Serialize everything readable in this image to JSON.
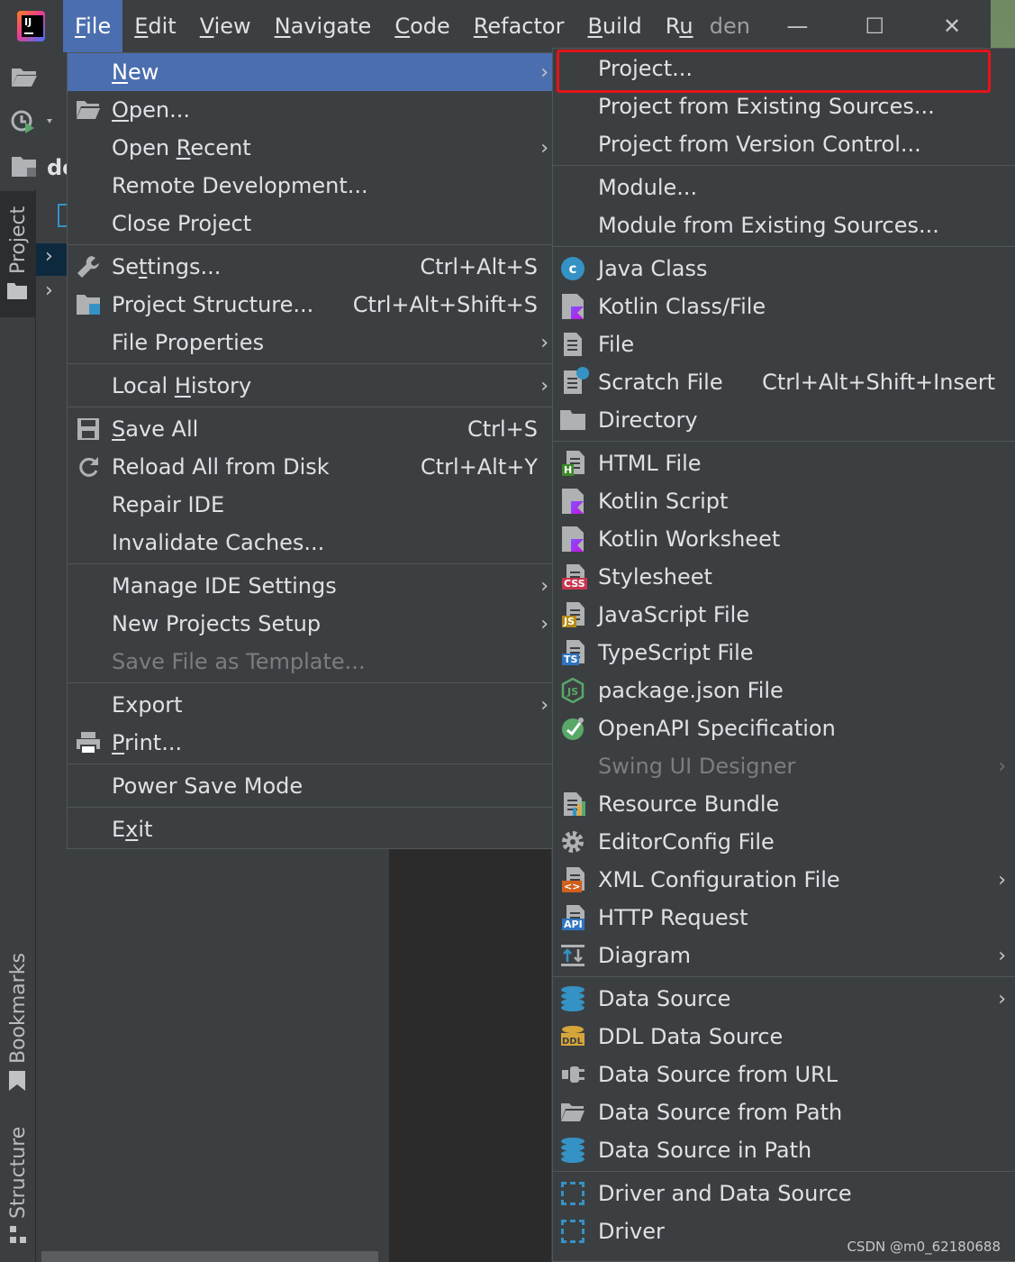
{
  "menubar": {
    "items": [
      "File",
      "Edit",
      "View",
      "Navigate",
      "Code",
      "Refactor",
      "Build",
      "Ru"
    ],
    "mnemonics": [
      "F",
      "E",
      "V",
      "N",
      "C",
      "R",
      "B",
      "u"
    ],
    "window_title": "den"
  },
  "side": {
    "project_tab": "Project",
    "bookmarks_tab": "Bookmarks",
    "structure_tab": "Structure",
    "project_name_fragment": "de"
  },
  "file_menu": [
    {
      "label": "New",
      "mn": "N",
      "submenu": true,
      "selected": true
    },
    {
      "label": "Open...",
      "mn": "O",
      "icon": "folder-open-icon"
    },
    {
      "label": "Open Recent",
      "mn": "R",
      "submenu": true
    },
    {
      "label": "Remote Development..."
    },
    {
      "label": "Close Project"
    },
    {
      "sep": true
    },
    {
      "label": "Settings...",
      "mn": "t",
      "shortcut": "Ctrl+Alt+S",
      "icon": "wrench-icon"
    },
    {
      "label": "Project Structure...",
      "shortcut": "Ctrl+Alt+Shift+S",
      "icon": "project-structure-icon"
    },
    {
      "label": "File Properties",
      "submenu": true
    },
    {
      "sep": true
    },
    {
      "label": "Local History",
      "mn": "H",
      "submenu": true
    },
    {
      "sep": true
    },
    {
      "label": "Save All",
      "mn": "S",
      "shortcut": "Ctrl+S",
      "icon": "save-icon"
    },
    {
      "label": "Reload All from Disk",
      "shortcut": "Ctrl+Alt+Y",
      "icon": "reload-icon"
    },
    {
      "label": "Repair IDE"
    },
    {
      "label": "Invalidate Caches..."
    },
    {
      "sep": true
    },
    {
      "label": "Manage IDE Settings",
      "submenu": true
    },
    {
      "label": "New Projects Setup",
      "submenu": true
    },
    {
      "label": "Save File as Template...",
      "disabled": true
    },
    {
      "sep": true
    },
    {
      "label": "Export",
      "submenu": true
    },
    {
      "label": "Print...",
      "mn": "P",
      "icon": "printer-icon"
    },
    {
      "sep": true
    },
    {
      "label": "Power Save Mode"
    },
    {
      "sep": true
    },
    {
      "label": "Exit",
      "mn": "x"
    }
  ],
  "new_menu": [
    {
      "label": "Project..."
    },
    {
      "label": "Project from Existing Sources..."
    },
    {
      "label": "Project from Version Control..."
    },
    {
      "sep": true
    },
    {
      "label": "Module..."
    },
    {
      "label": "Module from Existing Sources..."
    },
    {
      "sep": true
    },
    {
      "label": "Java Class",
      "icon": "java-class-icon"
    },
    {
      "label": "Kotlin Class/File",
      "icon": "kotlin-class-icon"
    },
    {
      "label": "File",
      "icon": "file-icon"
    },
    {
      "label": "Scratch File",
      "shortcut": "Ctrl+Alt+Shift+Insert",
      "icon": "scratch-file-icon"
    },
    {
      "label": "Directory",
      "icon": "folder-icon"
    },
    {
      "sep": true
    },
    {
      "label": "HTML File",
      "icon": "html-file-icon",
      "badge": "H",
      "badge_color": "#3d8a2a"
    },
    {
      "label": "Kotlin Script",
      "icon": "kotlin-script-icon"
    },
    {
      "label": "Kotlin Worksheet",
      "icon": "kotlin-worksheet-icon"
    },
    {
      "label": "Stylesheet",
      "icon": "stylesheet-icon",
      "badge": "CSS",
      "badge_color": "#c7354f"
    },
    {
      "label": "JavaScript File",
      "icon": "javascript-file-icon",
      "badge": "JS",
      "badge_color": "#b58a12"
    },
    {
      "label": "TypeScript File",
      "icon": "typescript-file-icon",
      "badge": "TS",
      "badge_color": "#2f74c0"
    },
    {
      "label": "package.json File",
      "icon": "nodejs-icon"
    },
    {
      "label": "OpenAPI Specification",
      "icon": "openapi-icon"
    },
    {
      "label": "Swing UI Designer",
      "disabled": true,
      "submenu": true
    },
    {
      "label": "Resource Bundle",
      "icon": "resource-bundle-icon"
    },
    {
      "label": "EditorConfig File",
      "icon": "gear-icon"
    },
    {
      "label": "XML Configuration File",
      "submenu": true,
      "icon": "xml-file-icon",
      "badge": "<>",
      "badge_color": "#d0601b"
    },
    {
      "label": "HTTP Request",
      "icon": "http-request-icon",
      "badge": "API",
      "badge_color": "#2f74c0"
    },
    {
      "label": "Diagram",
      "submenu": true,
      "icon": "diagram-icon"
    },
    {
      "sep": true
    },
    {
      "label": "Data Source",
      "submenu": true,
      "icon": "database-icon"
    },
    {
      "label": "DDL Data Source",
      "icon": "ddl-icon"
    },
    {
      "label": "Data Source from URL",
      "icon": "url-plug-icon"
    },
    {
      "label": "Data Source from Path",
      "icon": "folder-open-icon"
    },
    {
      "label": "Data Source in Path",
      "icon": "database-icon"
    },
    {
      "sep": true
    },
    {
      "label": "Driver and Data Source",
      "icon": "driver-icon"
    },
    {
      "label": "Driver",
      "icon": "driver-icon"
    }
  ],
  "watermark": "CSDN @m0_62180688",
  "colors": {
    "selection": "#4b6eaf",
    "menu_bg": "#3c3f41",
    "highlight_border": "#e4141b"
  }
}
